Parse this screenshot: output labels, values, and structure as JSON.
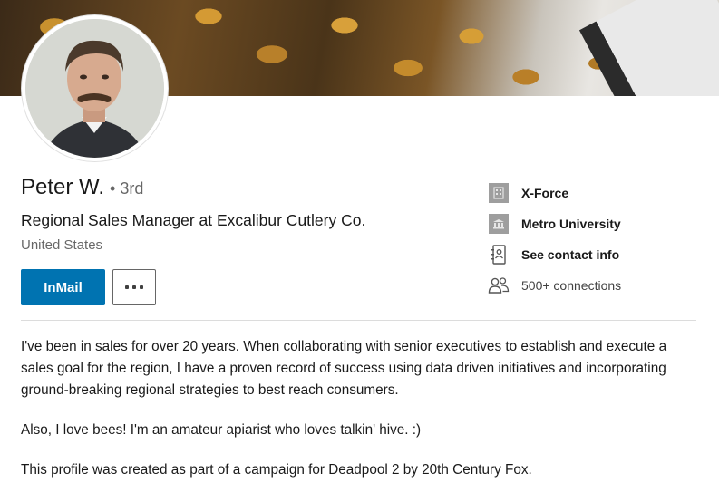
{
  "profile": {
    "name": "Peter W.",
    "degree": "• 3rd",
    "headline": "Regional Sales Manager at Excalibur Cutlery Co.",
    "location": "United States"
  },
  "actions": {
    "inmail_label": "InMail",
    "more_icon": "more-horizontal-icon"
  },
  "side_info": [
    {
      "icon": "company-logo-icon",
      "label": "X-Force"
    },
    {
      "icon": "school-logo-icon",
      "label": "Metro University"
    },
    {
      "icon": "contact-card-icon",
      "label": "See contact info"
    },
    {
      "icon": "connections-icon",
      "label": "500+ connections"
    }
  ],
  "summary": {
    "paragraph_1": "I've been in sales for over 20 years. When collaborating with senior executives to establish and execute a sales goal for the region, I have a proven record of success using data driven initiatives and incorporating ground-breaking regional strategies to best reach consumers.",
    "paragraph_2": "Also, I love bees! I'm an amateur apiarist who loves talkin' hive. :)",
    "paragraph_3": "This profile was created as part of a campaign for Deadpool 2 by 20th Century Fox."
  },
  "colors": {
    "primary_button": "#0073b1",
    "text": "#1a1a1a",
    "muted_text": "#666666"
  }
}
